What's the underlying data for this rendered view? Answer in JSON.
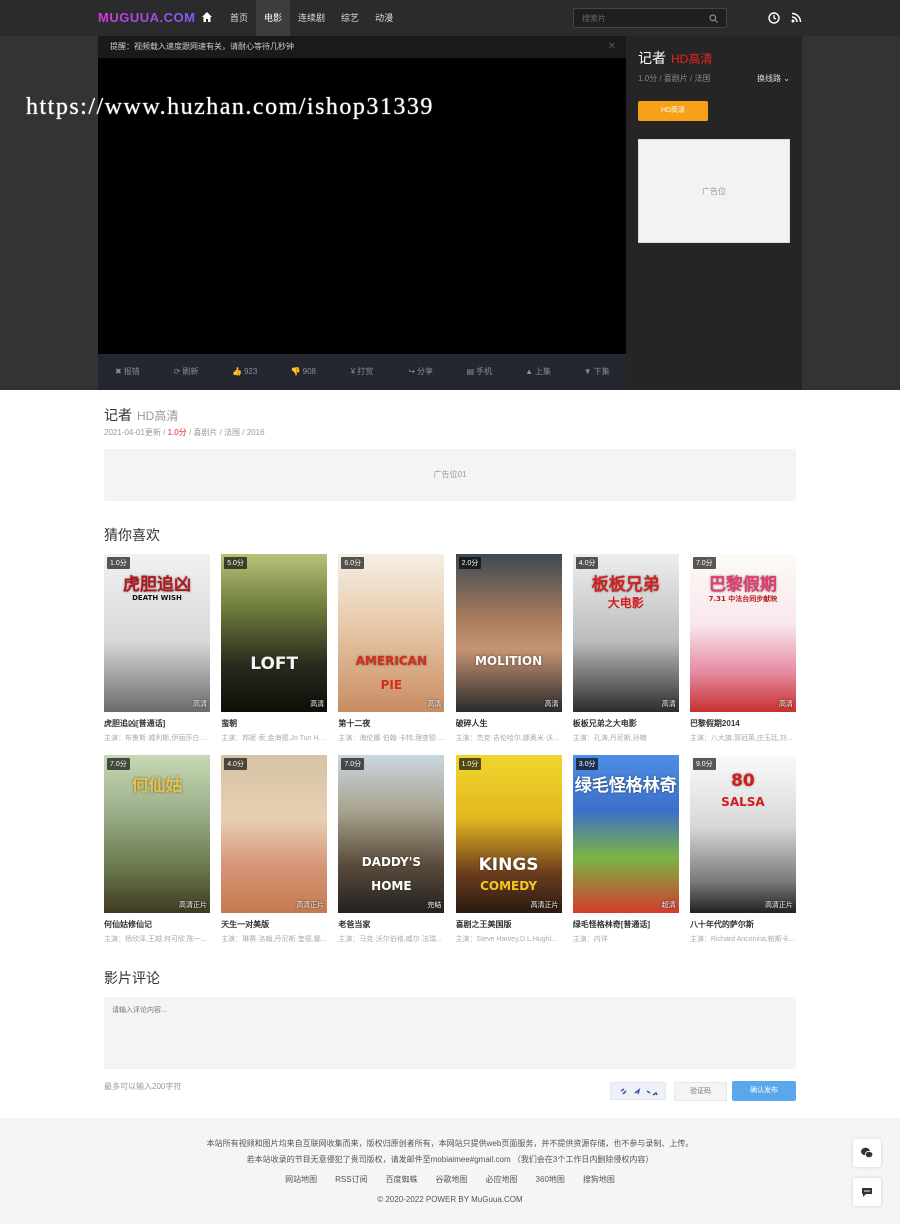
{
  "header": {
    "logo": "MUGUUA.COM",
    "nav": [
      "首页",
      "电影",
      "连续剧",
      "综艺",
      "动漫"
    ],
    "active_index": 1,
    "search_placeholder": "搜索片"
  },
  "player": {
    "notice": "提醒：视频载入速度跟网速有关，请耐心等待几秒钟",
    "watermark": "https://www.huzhan.com/ishop31339",
    "toolbar": [
      {
        "icon": "✖",
        "label": "报错"
      },
      {
        "icon": "⟳",
        "label": "刷新"
      },
      {
        "icon": "👍",
        "label": "923"
      },
      {
        "icon": "👎",
        "label": "908"
      },
      {
        "icon": "¥",
        "label": "打赏"
      },
      {
        "icon": "↪",
        "label": "分享"
      },
      {
        "icon": "▤",
        "label": "手机"
      },
      {
        "icon": "▲",
        "label": "上集"
      },
      {
        "icon": "▼",
        "label": "下集"
      }
    ]
  },
  "info_panel": {
    "title": "记者",
    "tag": "HD高清",
    "meta": "1.0分 / 喜剧片 / 法国",
    "line_switch": "换线路 ⌄",
    "episode_button": "HD高清",
    "ad": "广告位"
  },
  "detail": {
    "title": "记者",
    "tag": "HD高清",
    "meta_prefix": "2021-04-01更新 / ",
    "score": "1.0分",
    "meta_suffix": " / 喜剧片 / 法国 / 2016",
    "ad": "广告位01"
  },
  "recommend": {
    "title": "猜你喜欢",
    "items": [
      {
        "title": "虎胆追凶[普通话]",
        "actors": "主演：布鲁斯·威利斯,伊丽莎白·...",
        "score": "1.0分",
        "quality": "高清",
        "poster_text": "虎胆追凶",
        "poster_sub": "DEATH WISH",
        "bg": "linear-gradient(180deg,#f1f1f1 0%,#d8d8d8 55%,#6b6b6b 100%)",
        "fg": "#b1161b",
        "fg2": "#111"
      },
      {
        "title": "蛮朝",
        "actors": "主演：邦妮·索,金海德,Jo Tun Hy...",
        "score": "5.0分",
        "quality": "高清",
        "poster_text": "LOFT",
        "poster_sub": "",
        "bg": "linear-gradient(180deg,#b8c27a 0%,#6b7a3a 35%,#2b2a1e 70%,#0e0e0a 100%)",
        "fg": "#f4f4f4",
        "fg2": "#fff"
      },
      {
        "title": "第十二夜",
        "actors": "主演：海伦娜·伯翰·卡特,理查德·...",
        "score": "6.0分",
        "quality": "高清",
        "poster_text": "AMERICAN",
        "poster_sub": "PIE",
        "bg": "linear-gradient(180deg,#f4efe6 0%,#e7c9a9 45%,#c98c62 100%)",
        "fg": "#d62c1c",
        "fg2": "#d62c1c"
      },
      {
        "title": "破碎人生",
        "actors": "主演：杰克·吉伦哈尔,娜奥米·沃...",
        "score": "2.0分",
        "quality": "高清",
        "poster_text": "MOLITION",
        "poster_sub": "",
        "bg": "linear-gradient(180deg,#3d4a55 0%,#a67b5b 40%,#c69474 60%,#2a2a2a 100%)",
        "fg": "#fff",
        "fg2": "#fff"
      },
      {
        "title": "板板兄弟之大电影",
        "actors": "主演：孔涛,丹尼斯,孙楠",
        "score": "4.0分",
        "quality": "高清",
        "poster_text": "板板兄弟",
        "poster_sub": "大电影",
        "bg": "linear-gradient(180deg,#eeeeee 0%,#bcbcbc 55%,#2c2c2c 100%)",
        "fg": "#cf1f1f",
        "fg2": "#cf1f1f"
      },
      {
        "title": "巴黎假期2014",
        "actors": "主演：八大旗,郭冠英,庄玉廷,刘...",
        "score": "7.0分",
        "quality": "高清",
        "poster_text": "巴黎假期",
        "poster_sub": "7.31 中法台同步献映",
        "bg": "linear-gradient(180deg,#fdfbf6 0%,#f8e7ec 45%,#e48aa0 75%,#c8302f 100%)",
        "fg": "#e43b6b",
        "fg2": "#b32020"
      },
      {
        "title": "何仙姑修仙记",
        "actors": "主演：杨欣泽,王越,何可欣,陈一...",
        "score": "7.0分",
        "quality": "高清正片",
        "poster_text": "何仙姑",
        "poster_sub": "",
        "bg": "linear-gradient(180deg,#c7d9b3 0%,#9bb08b 35%,#6c7b4f 70%,#3f3a22 100%)",
        "fg": "#e8c24b",
        "fg2": "#e8c24b"
      },
      {
        "title": "天生一对美版",
        "actors": "主演：琳赛·洛翰,丹尼斯·奎德,娜...",
        "score": "4.0分",
        "quality": "高清正片",
        "poster_text": "",
        "poster_sub": "",
        "bg": "linear-gradient(180deg,#d6c2a5 0%,#e8cfb3 40%,#d59678 70%,#c47a4e 100%)",
        "fg": "#fff",
        "fg2": "#fff"
      },
      {
        "title": "老爸当家",
        "actors": "主演：马克·沃尔伯格,威尔·法瑞...",
        "score": "7.0分",
        "quality": "完结",
        "poster_text": "DADDY'S",
        "poster_sub": "HOME",
        "bg": "linear-gradient(180deg,#c9d7e2 0%,#a8a38f 35%,#5a4a3a 70%,#222 100%)",
        "fg": "#fff",
        "fg2": "#fff"
      },
      {
        "title": "喜剧之王美国版",
        "actors": "主演：Steve Harvey,D.L.Hughl...",
        "score": "1.0分",
        "quality": "高清正片",
        "poster_text": "KINGS",
        "poster_sub": "COMEDY",
        "bg": "linear-gradient(180deg,#f0d62e 0%,#e3b71f 40%,#6b3c1f 75%,#2a1a10 100%)",
        "fg": "#fff",
        "fg2": "#f2c81e"
      },
      {
        "title": "绿毛怪格林奇[普通话]",
        "actors": "主演：内详",
        "score": "3.0分",
        "quality": "超清",
        "poster_text": "绿毛怪格林奇",
        "poster_sub": "",
        "bg": "linear-gradient(180deg,#4f8ee6 0%,#3c6fc9 35%,#7bb544 65%,#d33a2e 100%)",
        "fg": "#fff",
        "fg2": "#fff"
      },
      {
        "title": "八十年代的萨尔斯",
        "actors": "主演：Richard Anconina,帕斯卡...",
        "score": "9.0分",
        "quality": "高清正片",
        "poster_text": "80",
        "poster_sub": "SALSA",
        "bg": "linear-gradient(180deg,#fafafa 0%,#d8d8d8 45%,#7a7a7a 80%,#222 100%)",
        "fg": "#d11c1c",
        "fg2": "#d11c1c"
      }
    ]
  },
  "comments": {
    "title": "影片评论",
    "placeholder": "请输入评论内容...",
    "hint": "最多可以输入200字符",
    "captcha_code": "⁂ ↗ ◆",
    "captcha_placeholder": "验证码",
    "submit": "确认发布"
  },
  "footer": {
    "line1": "本站所有视频和图片均来自互联网收集而来，版权归原创者所有，本网站只提供web页面服务，并不提供资源存储，也不参与录制、上传。",
    "line2": "若本站收录的节目无意侵犯了贵司版权，请发邮件至mobiaimee#gmail.com （我们会在3个工作日内删除侵权内容）",
    "links": [
      "网站地图",
      "RSS订阅",
      "百度蜘蛛",
      "谷歌地图",
      "必应地图",
      "360地图",
      "搜狗地图"
    ],
    "copyright": "© 2020-2022 POWER BY MuGuua.COM"
  },
  "colors": {
    "accent_red": "#e52525",
    "orange": "#f7a118",
    "blue": "#5ba7ee"
  }
}
